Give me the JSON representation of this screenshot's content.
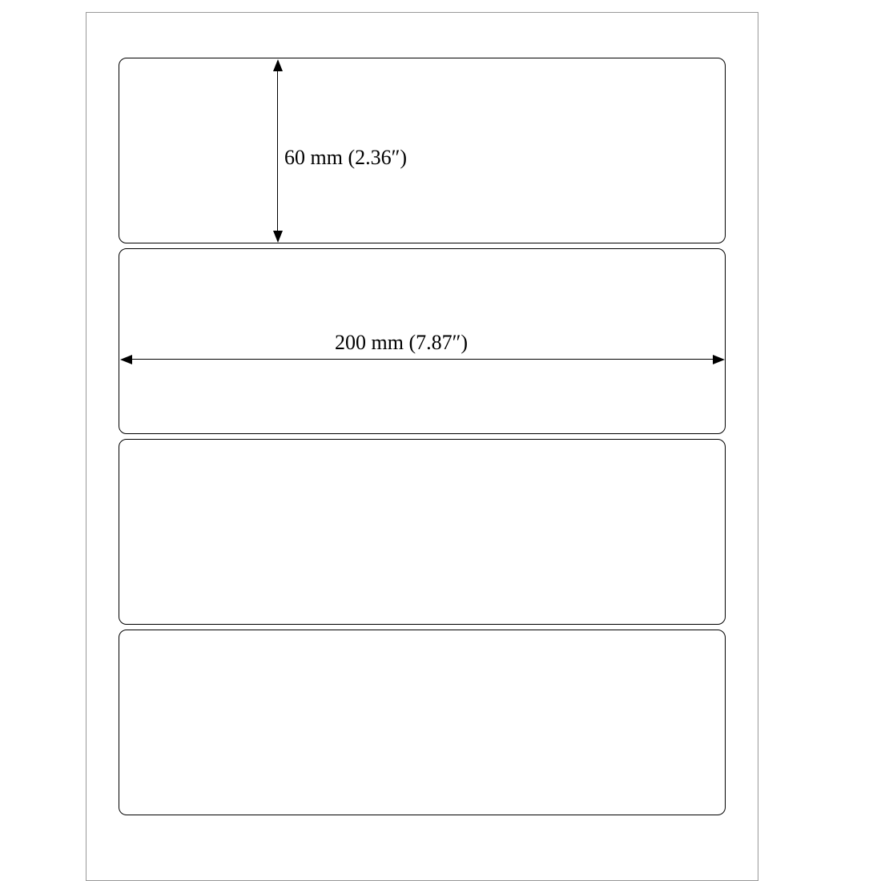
{
  "diagram": {
    "height_label": "60 mm (2.36″)",
    "width_label": "200 mm (7.87″)",
    "label_count": 4,
    "label_width_mm": 200,
    "label_height_mm": 60,
    "label_width_in": 7.87,
    "label_height_in": 2.36
  }
}
